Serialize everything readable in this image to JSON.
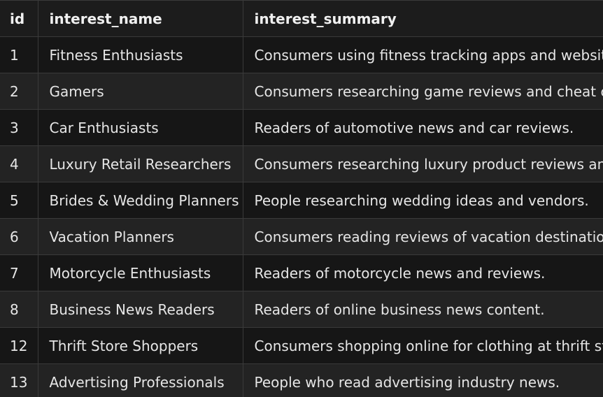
{
  "table": {
    "columns": [
      "id",
      "interest_name",
      "interest_summary"
    ],
    "rows": [
      {
        "id": "1",
        "interest_name": "Fitness Enthusiasts",
        "interest_summary": "Consumers using fitness tracking apps and websites."
      },
      {
        "id": "2",
        "interest_name": "Gamers",
        "interest_summary": "Consumers researching game reviews and cheat cod"
      },
      {
        "id": "3",
        "interest_name": "Car Enthusiasts",
        "interest_summary": "Readers of automotive news and car reviews."
      },
      {
        "id": "4",
        "interest_name": "Luxury Retail Researchers",
        "interest_summary": "Consumers researching luxury product reviews and g"
      },
      {
        "id": "5",
        "interest_name": "Brides & Wedding Planners",
        "interest_summary": "People researching wedding ideas and vendors."
      },
      {
        "id": "6",
        "interest_name": "Vacation Planners",
        "interest_summary": "Consumers reading reviews of vacation destinations"
      },
      {
        "id": "7",
        "interest_name": "Motorcycle Enthusiasts",
        "interest_summary": "Readers of motorcycle news and reviews."
      },
      {
        "id": "8",
        "interest_name": "Business News Readers",
        "interest_summary": "Readers of online business news content."
      },
      {
        "id": "12",
        "interest_name": "Thrift Store Shoppers",
        "interest_summary": "Consumers shopping online for clothing at thrift stor"
      },
      {
        "id": "13",
        "interest_name": "Advertising Professionals",
        "interest_summary": "People who read advertising industry news."
      }
    ]
  },
  "colors": {
    "background": "#1a1a1a",
    "row_odd": "#161616",
    "row_even": "#232323",
    "grid": "#3a3a3a",
    "text": "#e6e6e6"
  }
}
